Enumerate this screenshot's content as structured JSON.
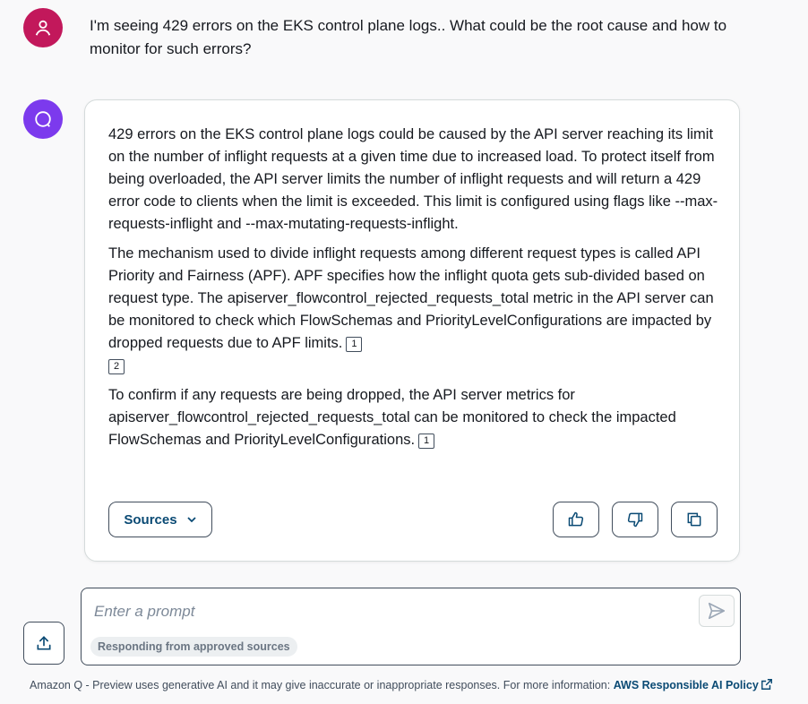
{
  "user_message": {
    "text": "I'm seeing 429 errors on the EKS control plane logs.. What could be the root cause and how to monitor for such errors?"
  },
  "assistant_message": {
    "p1": "429 errors on the EKS control plane logs could be caused by the API server reaching its limit on the number of inflight requests at a given time due to increased load. To protect itself from being overloaded, the API server limits the number of inflight requests and will return a 429 error code to clients when the limit is exceeded. This limit is configured using flags like --max-requests-inflight and --max-mutating-requests-inflight.",
    "p2": "The mechanism used to divide inflight requests among different request types is called API Priority and Fairness (APF). APF specifies how the inflight quota gets sub-divided based on request type. The apiserver_flowcontrol_rejected_requests_total metric in the API server can be monitored to check which FlowSchemas and PriorityLevelConfigurations are impacted by dropped requests due to APF limits.",
    "p2_refs": [
      "1",
      "2"
    ],
    "p3": "To confirm if any requests are being dropped, the API server metrics for apiserver_flowcontrol_rejected_requests_total can be monitored to check the impacted FlowSchemas and PriorityLevelConfigurations.",
    "p3_refs": [
      "1"
    ]
  },
  "actions": {
    "sources_label": "Sources"
  },
  "prompt": {
    "placeholder": "Enter a prompt",
    "value": "",
    "badge": "Responding from approved sources"
  },
  "footer": {
    "text": "Amazon Q - Preview uses generative AI and it may give inaccurate or inappropriate responses. For more information: ",
    "link": "AWS Responsible AI Policy"
  },
  "colors": {
    "user_avatar": "#c2185b",
    "bot_avatar": "#7c3aed",
    "link": "#0a4a74"
  },
  "icons": {
    "user": "user-icon",
    "bot": "chat-bubble-icon",
    "thumbs_up": "thumbs-up-icon",
    "thumbs_down": "thumbs-down-icon",
    "copy": "copy-icon",
    "upload": "upload-icon",
    "send": "send-icon",
    "external": "external-link-icon"
  }
}
